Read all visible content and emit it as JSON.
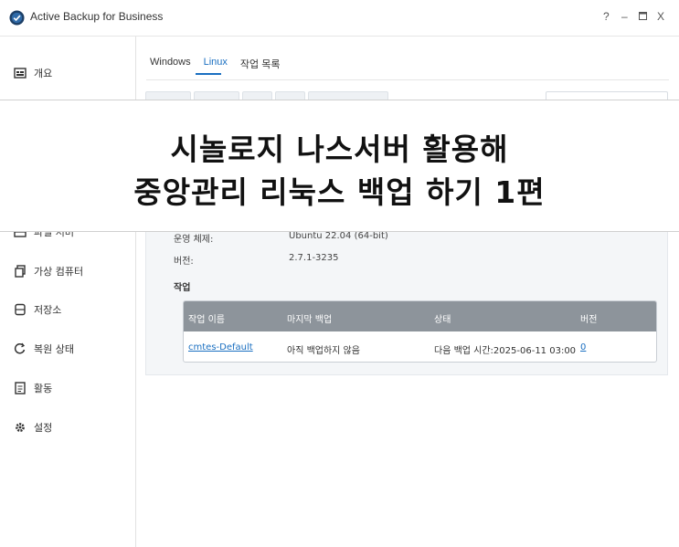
{
  "window": {
    "title": "Active Backup for Business",
    "help_label": "?",
    "minimize_label": "–",
    "maximize_label": "▫",
    "close_label": "X"
  },
  "sidebar": {
    "items": [
      {
        "label": "개요",
        "icon": "overview-icon"
      },
      {
        "label": "파일 서버",
        "icon": "file-server-icon"
      },
      {
        "label": "가상 컴퓨터",
        "icon": "virtual-machine-icon"
      },
      {
        "label": "저장소",
        "icon": "storage-icon"
      },
      {
        "label": "복원 상태",
        "icon": "restore-status-icon"
      },
      {
        "label": "활동",
        "icon": "activity-icon"
      },
      {
        "label": "설정",
        "icon": "gear-icon"
      }
    ]
  },
  "tabs": [
    {
      "label": "Windows"
    },
    {
      "label": "Linux"
    },
    {
      "label": "작업 목록"
    }
  ],
  "details": {
    "os_label": "운영 체제:",
    "os_value": "Ubuntu 22.04 (64-bit)",
    "version_label": "버전:",
    "version_value": "2.7.1-3235"
  },
  "jobs": {
    "section_title": "작업",
    "columns": [
      "작업 이름",
      "마지막 백업",
      "상태",
      "버전"
    ],
    "rows": [
      {
        "name": "cmtes-Default",
        "last_backup": "아직 백업하지 않음",
        "status": "다음 백업 시간:2025-06-11 03:00",
        "version": "0"
      }
    ]
  },
  "banner": {
    "line1": "시놀로지 나스서버 활용해",
    "line2": "중앙관리 리눅스 백업 하기 1편"
  },
  "colors": {
    "accent": "#1a6fc1",
    "table_header": "#8d949b",
    "panel_bg": "#f4f6f8"
  }
}
